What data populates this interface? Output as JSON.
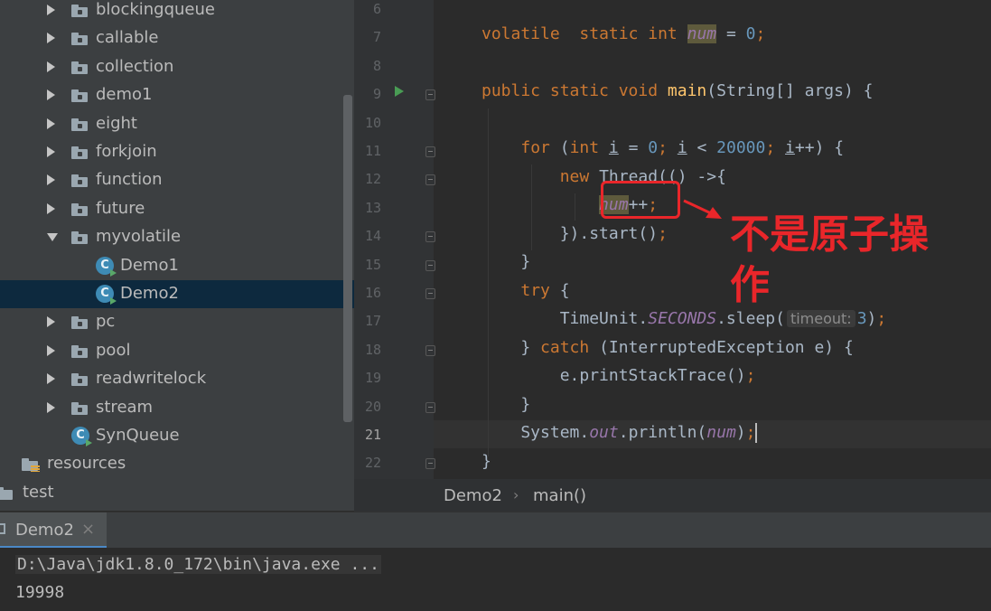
{
  "project_tree": {
    "items": [
      {
        "label": "blockingqueue",
        "type": "package",
        "state": "collapsed"
      },
      {
        "label": "callable",
        "type": "package",
        "state": "collapsed"
      },
      {
        "label": "collection",
        "type": "package",
        "state": "collapsed"
      },
      {
        "label": "demo1",
        "type": "package",
        "state": "collapsed"
      },
      {
        "label": "eight",
        "type": "package",
        "state": "collapsed"
      },
      {
        "label": "forkjoin",
        "type": "package",
        "state": "collapsed"
      },
      {
        "label": "function",
        "type": "package",
        "state": "collapsed"
      },
      {
        "label": "future",
        "type": "package",
        "state": "collapsed"
      },
      {
        "label": "myvolatile",
        "type": "package",
        "state": "expanded"
      },
      {
        "label": "Demo1",
        "type": "class"
      },
      {
        "label": "Demo2",
        "type": "class",
        "selected": true
      },
      {
        "label": "pc",
        "type": "package",
        "state": "collapsed"
      },
      {
        "label": "pool",
        "type": "package",
        "state": "collapsed"
      },
      {
        "label": "readwritelock",
        "type": "package",
        "state": "collapsed"
      },
      {
        "label": "stream",
        "type": "package",
        "state": "collapsed"
      },
      {
        "label": "SynQueue",
        "type": "class"
      },
      {
        "label": "resources",
        "type": "resources-folder"
      },
      {
        "label": "test",
        "type": "folder"
      }
    ]
  },
  "editor": {
    "line_numbers": [
      "6",
      "7",
      "8",
      "9",
      "10",
      "11",
      "12",
      "13",
      "14",
      "15",
      "16",
      "17",
      "18",
      "19",
      "20",
      "21",
      "22"
    ],
    "current_line": "21",
    "param_hint": "timeout:"
  },
  "annotation": {
    "text": "不是原子操作",
    "color": "#e9262a"
  },
  "breadcrumb": {
    "class_name": "Demo2",
    "separator": "›",
    "method_name": "main()"
  },
  "run_panel": {
    "tab_label": "Demo2",
    "tab_close": "×",
    "console_command": "D:\\Java\\jdk1.8.0_172\\bin\\java.exe ...",
    "console_output": "19998"
  },
  "colors": {
    "keyword": "#cc7832",
    "number": "#6897bb",
    "field": "#9876aa",
    "method_decl": "#ffc66d",
    "text": "#a9b7c6",
    "selection": "#0d293e"
  }
}
